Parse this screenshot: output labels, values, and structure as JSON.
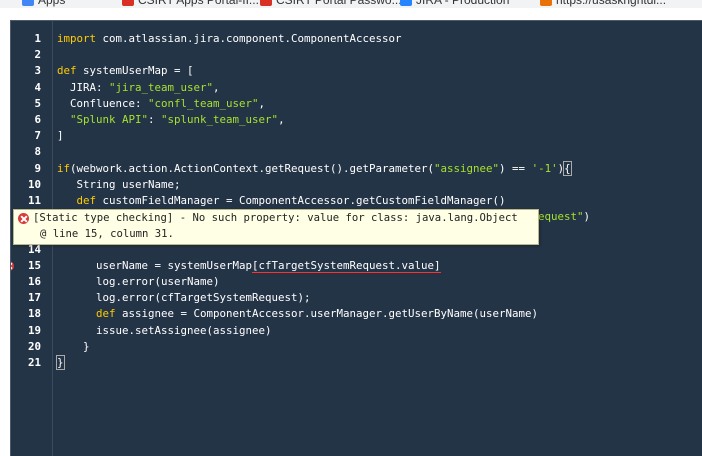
{
  "bookmarks_bar": {
    "items": [
      {
        "label": "Apps",
        "color": "#4285f4"
      },
      {
        "label": "CSIRT Apps Portal-II...",
        "color": "#d93025"
      },
      {
        "label": "CSIRT Portal Passwo...",
        "color": "#d93025"
      },
      {
        "label": "JIRA - Production",
        "color": "#2684ff"
      },
      {
        "label": "https://usaskrightdi...",
        "color": "#e8710a"
      }
    ]
  },
  "editor": {
    "lines": [
      {
        "num": "1",
        "tokens": [
          {
            "t": "kw",
            "v": "import"
          },
          {
            "t": "id",
            "v": " com.atlassian.jira.component.ComponentAccessor"
          }
        ]
      },
      {
        "num": "2",
        "tokens": []
      },
      {
        "num": "3",
        "tokens": [
          {
            "t": "kw",
            "v": "def"
          },
          {
            "t": "id",
            "v": " systemUserMap = ["
          }
        ]
      },
      {
        "num": "4",
        "tokens": [
          {
            "t": "id",
            "v": "  JIRA: "
          },
          {
            "t": "str",
            "v": "\"jira_team_user\""
          },
          {
            "t": "id",
            "v": ","
          }
        ]
      },
      {
        "num": "5",
        "tokens": [
          {
            "t": "id",
            "v": "  Confluence: "
          },
          {
            "t": "str",
            "v": "\"confl_team_user\""
          },
          {
            "t": "id",
            "v": ","
          }
        ]
      },
      {
        "num": "6",
        "tokens": [
          {
            "t": "id",
            "v": "  "
          },
          {
            "t": "str",
            "v": "\"Splunk API\""
          },
          {
            "t": "id",
            "v": ": "
          },
          {
            "t": "str",
            "v": "\"splunk_team_user\""
          },
          {
            "t": "id",
            "v": ","
          }
        ]
      },
      {
        "num": "7",
        "tokens": [
          {
            "t": "id",
            "v": "]"
          }
        ]
      },
      {
        "num": "8",
        "tokens": []
      },
      {
        "num": "9",
        "tokens": [
          {
            "t": "kw",
            "v": "if"
          },
          {
            "t": "id",
            "v": "(webwork.action.ActionContext.getRequest().getParameter("
          },
          {
            "t": "str",
            "v": "\"assignee\""
          },
          {
            "t": "id",
            "v": ") == "
          },
          {
            "t": "str",
            "v": "'-1'"
          },
          {
            "t": "id",
            "v": ")"
          },
          {
            "t": "bracket",
            "v": "{"
          }
        ]
      },
      {
        "num": "10",
        "tokens": [
          {
            "t": "id",
            "v": "   String userName;"
          }
        ]
      },
      {
        "num": "11",
        "tokens": [
          {
            "t": "kw",
            "v": "   def"
          },
          {
            "t": "id",
            "v": " customFieldManager = ComponentAccessor.getCustomFieldManager()"
          }
        ]
      },
      {
        "num": "12",
        "tokens": [
          {
            "t": "kw",
            "v": "   def"
          },
          {
            "t": "id",
            "v": " cf = customFieldManager.getCustomFieldObjectByName("
          },
          {
            "t": "str",
            "v": "\"Target System Request\""
          },
          {
            "t": "id",
            "v": ")"
          }
        ]
      },
      {
        "num": "13",
        "tokens": []
      },
      {
        "num": "14",
        "tokens": []
      },
      {
        "num": "15",
        "error": true,
        "tokens": [
          {
            "t": "id",
            "v": "      userName = systemUserMap"
          },
          {
            "t": "err",
            "v": "[cfTargetSystemRequest.value]"
          }
        ]
      },
      {
        "num": "16",
        "tokens": [
          {
            "t": "id",
            "v": "      log.error(userName)"
          }
        ]
      },
      {
        "num": "17",
        "tokens": [
          {
            "t": "id",
            "v": "      log.error(cfTargetSystemRequest);"
          }
        ]
      },
      {
        "num": "18",
        "tokens": [
          {
            "t": "kw",
            "v": "      def"
          },
          {
            "t": "id",
            "v": " assignee = ComponentAccessor.userManager.getUserByName(userName)"
          }
        ]
      },
      {
        "num": "19",
        "tokens": [
          {
            "t": "id",
            "v": "      issue.setAssignee(assignee)"
          }
        ]
      },
      {
        "num": "20",
        "tokens": [
          {
            "t": "id",
            "v": "    }"
          }
        ]
      },
      {
        "num": "21",
        "tokens": [
          {
            "t": "bracket",
            "v": "}"
          }
        ]
      }
    ]
  },
  "tooltip": {
    "line1": "[Static type checking] - No such property: value for class: java.lang.Object",
    "line2": "@ line 15, column 31."
  },
  "colors": {
    "editor_bg": "#243447",
    "keyword": "#ffcc00",
    "string": "#a6e22e",
    "text": "#ffffff",
    "error": "#d93a3a",
    "tooltip_bg": "#ffffe6"
  }
}
